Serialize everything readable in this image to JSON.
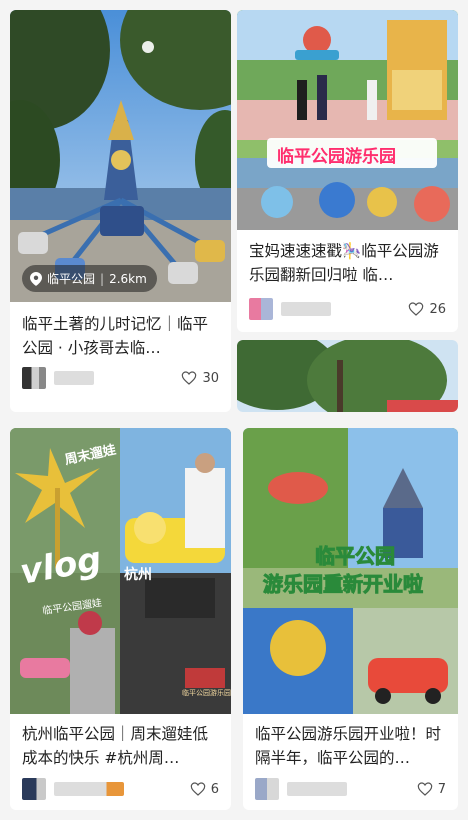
{
  "feed": {
    "card1": {
      "title": "临平土著的儿时记忆｜临平公园 · 小孩哥去临…",
      "location": {
        "name": "临平公园",
        "distance": "2.6km",
        "icon": "location-pin-icon"
      },
      "likes": "30"
    },
    "card2": {
      "overlay": "临平公园游乐园",
      "title": "宝妈速速速戳🎠临平公园游乐园翻新回归啦 临…",
      "likes": "26"
    },
    "card3": {
      "overlay": {
        "weekend": "周末遛娃",
        "vlog": "vlog",
        "sub": "临平公园遛娃",
        "city": "杭州",
        "sign": "临平公园游乐园"
      },
      "title": "杭州临平公园｜周末遛娃低成本的快乐 #杭州周…",
      "likes": "6"
    },
    "card4": {
      "overlay": {
        "line1": "临平公园",
        "line2": "游乐园重新开业啦"
      },
      "title": "临平公园游乐园开业啦！时隔半年，临平公园的…",
      "likes": "7"
    }
  },
  "colors": {
    "accent_pink": "#ff2e6e",
    "like_icon": "#555555"
  }
}
